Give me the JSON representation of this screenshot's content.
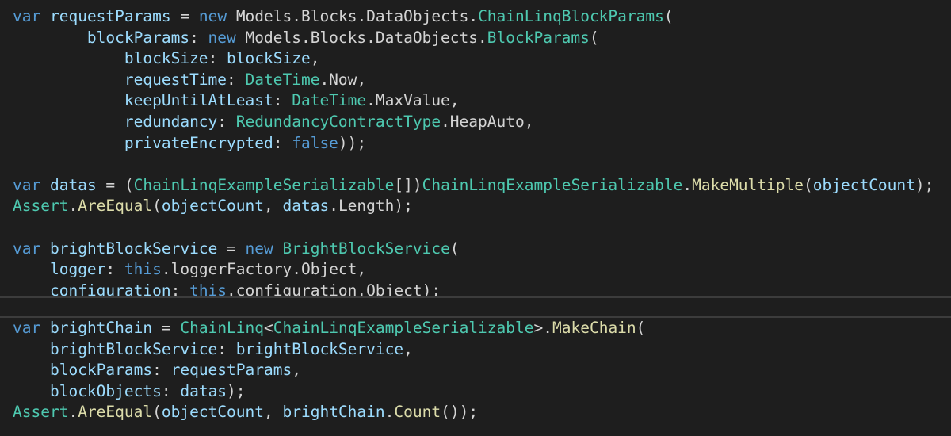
{
  "colors": {
    "background": "#1e1e1e",
    "keyword": "#569cd6",
    "variable": "#9cdcfe",
    "type": "#4ec9b0",
    "method": "#dcdcaa",
    "plain": "#d4d4d4",
    "split_bar": "#3c3c3c"
  },
  "editor": {
    "top_pane": {
      "lines": [
        [
          {
            "t": "kw",
            "v": "var"
          },
          {
            "t": "plain",
            "v": " "
          },
          {
            "t": "var",
            "v": "requestParams"
          },
          {
            "t": "plain",
            "v": " = "
          },
          {
            "t": "kw",
            "v": "new"
          },
          {
            "t": "plain",
            "v": " Models.Blocks.DataObjects."
          },
          {
            "t": "type",
            "v": "ChainLinqBlockParams"
          },
          {
            "t": "plain",
            "v": "("
          }
        ],
        [
          {
            "t": "plain",
            "v": "        "
          },
          {
            "t": "var",
            "v": "blockParams"
          },
          {
            "t": "plain",
            "v": ": "
          },
          {
            "t": "kw",
            "v": "new"
          },
          {
            "t": "plain",
            "v": " Models.Blocks.DataObjects."
          },
          {
            "t": "type",
            "v": "BlockParams"
          },
          {
            "t": "plain",
            "v": "("
          }
        ],
        [
          {
            "t": "plain",
            "v": "            "
          },
          {
            "t": "var",
            "v": "blockSize"
          },
          {
            "t": "plain",
            "v": ": "
          },
          {
            "t": "var",
            "v": "blockSize"
          },
          {
            "t": "plain",
            "v": ","
          }
        ],
        [
          {
            "t": "plain",
            "v": "            "
          },
          {
            "t": "var",
            "v": "requestTime"
          },
          {
            "t": "plain",
            "v": ": "
          },
          {
            "t": "type",
            "v": "DateTime"
          },
          {
            "t": "plain",
            "v": ".Now,"
          }
        ],
        [
          {
            "t": "plain",
            "v": "            "
          },
          {
            "t": "var",
            "v": "keepUntilAtLeast"
          },
          {
            "t": "plain",
            "v": ": "
          },
          {
            "t": "type",
            "v": "DateTime"
          },
          {
            "t": "plain",
            "v": ".MaxValue,"
          }
        ],
        [
          {
            "t": "plain",
            "v": "            "
          },
          {
            "t": "var",
            "v": "redundancy"
          },
          {
            "t": "plain",
            "v": ": "
          },
          {
            "t": "type",
            "v": "RedundancyContractType"
          },
          {
            "t": "plain",
            "v": ".HeapAuto,"
          }
        ],
        [
          {
            "t": "plain",
            "v": "            "
          },
          {
            "t": "var",
            "v": "privateEncrypted"
          },
          {
            "t": "plain",
            "v": ": "
          },
          {
            "t": "kw",
            "v": "false"
          },
          {
            "t": "plain",
            "v": "));"
          }
        ],
        [],
        [
          {
            "t": "kw",
            "v": "var"
          },
          {
            "t": "plain",
            "v": " "
          },
          {
            "t": "var",
            "v": "datas"
          },
          {
            "t": "plain",
            "v": " = ("
          },
          {
            "t": "type",
            "v": "ChainLinqExampleSerializable"
          },
          {
            "t": "plain",
            "v": "[])"
          },
          {
            "t": "type",
            "v": "ChainLinqExampleSerializable"
          },
          {
            "t": "plain",
            "v": "."
          },
          {
            "t": "fn",
            "v": "MakeMultiple"
          },
          {
            "t": "plain",
            "v": "("
          },
          {
            "t": "var",
            "v": "objectCount"
          },
          {
            "t": "plain",
            "v": ");"
          }
        ],
        [
          {
            "t": "type",
            "v": "Assert"
          },
          {
            "t": "plain",
            "v": "."
          },
          {
            "t": "fn",
            "v": "AreEqual"
          },
          {
            "t": "plain",
            "v": "("
          },
          {
            "t": "var",
            "v": "objectCount"
          },
          {
            "t": "plain",
            "v": ", "
          },
          {
            "t": "var",
            "v": "datas"
          },
          {
            "t": "plain",
            "v": ".Length);"
          }
        ],
        [],
        [
          {
            "t": "kw",
            "v": "var"
          },
          {
            "t": "plain",
            "v": " "
          },
          {
            "t": "var",
            "v": "brightBlockService"
          },
          {
            "t": "plain",
            "v": " = "
          },
          {
            "t": "kw",
            "v": "new"
          },
          {
            "t": "plain",
            "v": " "
          },
          {
            "t": "type",
            "v": "BrightBlockService"
          },
          {
            "t": "plain",
            "v": "("
          }
        ],
        [
          {
            "t": "plain",
            "v": "    "
          },
          {
            "t": "var",
            "v": "logger"
          },
          {
            "t": "plain",
            "v": ": "
          },
          {
            "t": "kw",
            "v": "this"
          },
          {
            "t": "plain",
            "v": ".loggerFactory.Object,"
          }
        ],
        [
          {
            "t": "plain",
            "v": "    "
          },
          {
            "t": "var",
            "v": "configuration"
          },
          {
            "t": "plain",
            "v": ": "
          },
          {
            "t": "kw",
            "v": "this"
          },
          {
            "t": "plain",
            "v": ".configuration.Object);"
          }
        ]
      ]
    },
    "bottom_pane": {
      "lines": [
        [
          {
            "t": "kw",
            "v": "var"
          },
          {
            "t": "plain",
            "v": " "
          },
          {
            "t": "var",
            "v": "brightChain"
          },
          {
            "t": "plain",
            "v": " = "
          },
          {
            "t": "type",
            "v": "ChainLinq"
          },
          {
            "t": "plain",
            "v": "<"
          },
          {
            "t": "type",
            "v": "ChainLinqExampleSerializable"
          },
          {
            "t": "plain",
            "v": ">."
          },
          {
            "t": "fn",
            "v": "MakeChain"
          },
          {
            "t": "plain",
            "v": "("
          }
        ],
        [
          {
            "t": "plain",
            "v": "    "
          },
          {
            "t": "var",
            "v": "brightBlockService"
          },
          {
            "t": "plain",
            "v": ": "
          },
          {
            "t": "var",
            "v": "brightBlockService"
          },
          {
            "t": "plain",
            "v": ","
          }
        ],
        [
          {
            "t": "plain",
            "v": "    "
          },
          {
            "t": "var",
            "v": "blockParams"
          },
          {
            "t": "plain",
            "v": ": "
          },
          {
            "t": "var",
            "v": "requestParams"
          },
          {
            "t": "plain",
            "v": ","
          }
        ],
        [
          {
            "t": "plain",
            "v": "    "
          },
          {
            "t": "var",
            "v": "blockObjects"
          },
          {
            "t": "plain",
            "v": ": "
          },
          {
            "t": "var",
            "v": "datas"
          },
          {
            "t": "plain",
            "v": ");"
          }
        ],
        [
          {
            "t": "type",
            "v": "Assert"
          },
          {
            "t": "plain",
            "v": "."
          },
          {
            "t": "fn",
            "v": "AreEqual"
          },
          {
            "t": "plain",
            "v": "("
          },
          {
            "t": "var",
            "v": "objectCount"
          },
          {
            "t": "plain",
            "v": ", "
          },
          {
            "t": "var",
            "v": "brightChain"
          },
          {
            "t": "plain",
            "v": "."
          },
          {
            "t": "fn",
            "v": "Count"
          },
          {
            "t": "plain",
            "v": "());"
          }
        ]
      ]
    }
  }
}
